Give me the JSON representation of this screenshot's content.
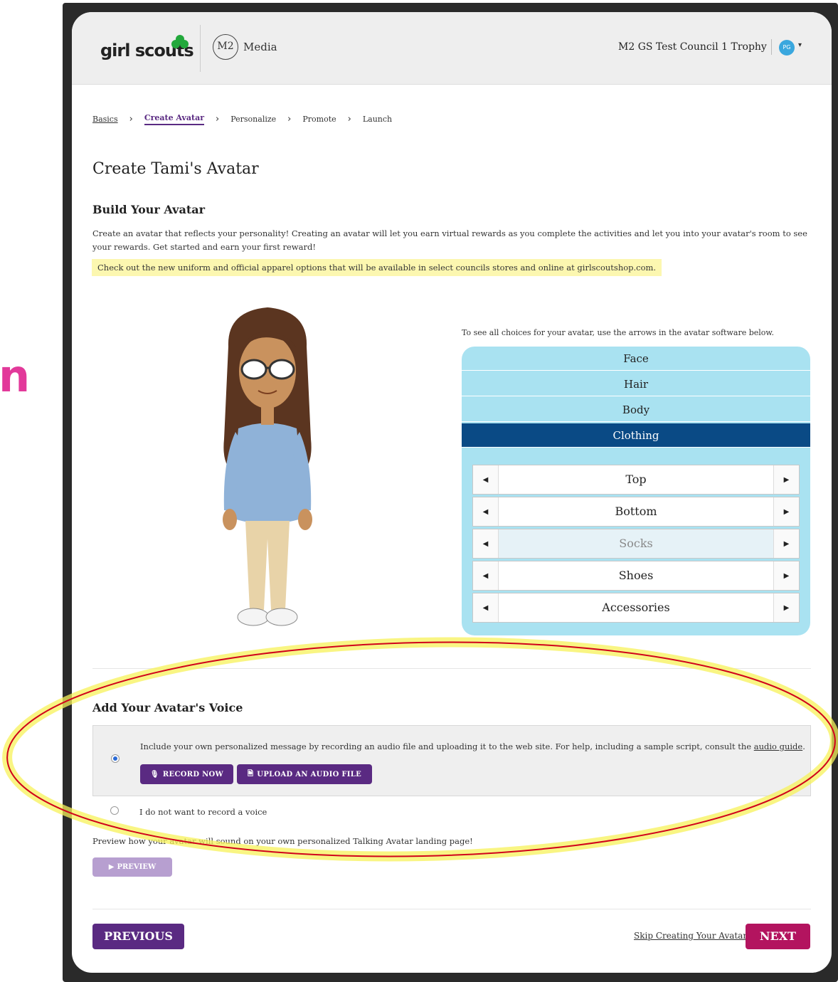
{
  "side_letter": "n",
  "header": {
    "logo_text": "girl scouts",
    "m2_label": "M2",
    "media_label": "Media",
    "council": "M2 GS Test Council 1 Trophy",
    "user_initials": "PG"
  },
  "breadcrumb": {
    "items": [
      "Basics",
      "Create Avatar",
      "Personalize",
      "Promote",
      "Launch"
    ],
    "active": "Create Avatar"
  },
  "page": {
    "title": "Create Tami's Avatar",
    "build_heading": "Build Your Avatar",
    "build_text": "Create an avatar that reflects your personality! Creating an avatar will let you earn virtual rewards as you complete the activities and let you into your avatar's room to see your rewards. Get started and earn your first reward!",
    "notice": "Check out the new uniform and official apparel options that will be available in select councils stores and online at girlscoutshop.com."
  },
  "avatar_builder": {
    "hint": "To see all choices for your avatar, use the arrows in the avatar software below.",
    "categories": [
      "Face",
      "Hair",
      "Body",
      "Clothing"
    ],
    "active_category": "Clothing",
    "options": [
      "Top",
      "Bottom",
      "Socks",
      "Shoes",
      "Accessories"
    ],
    "disabled_option": "Socks"
  },
  "voice": {
    "heading": "Add Your Avatar's Voice",
    "option1_text": "Include your own personalized message by recording an audio file and uploading it to the web site. For help, including a sample script, consult the ",
    "option1_link": "audio guide",
    "record_label": "RECORD NOW",
    "upload_label": "UPLOAD AN AUDIO FILE",
    "option2_text": "I do not want to record a voice",
    "preview_text": "Preview how your avatar will sound on your own personalized Talking Avatar landing page!",
    "preview_label": "PREVIEW"
  },
  "footer": {
    "previous_label": "PREVIOUS",
    "skip_label": "Skip Creating Your Avatar",
    "next_label": "NEXT"
  },
  "colors": {
    "brand_purple": "#5a2a82",
    "next_magenta": "#b3145f",
    "panel_blue": "#a9e2f1",
    "active_category": "#0a4a85",
    "highlight_red": "#d0021b",
    "highlight_yellow": "#f7f25a"
  }
}
